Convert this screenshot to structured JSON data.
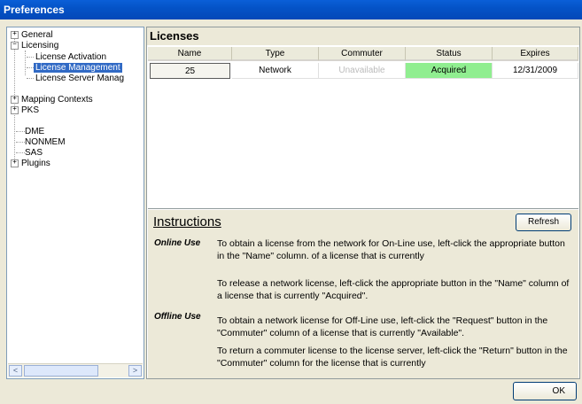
{
  "window": {
    "title": "Preferences"
  },
  "tree": {
    "items": [
      {
        "label": "General",
        "expander": "+"
      },
      {
        "label": "Licensing",
        "expander": "−"
      },
      {
        "label": "License Activation"
      },
      {
        "label": "License Management"
      },
      {
        "label": "License Server Manag"
      },
      {
        "label": "Mapping Contexts",
        "expander": "+"
      },
      {
        "label": "PKS",
        "expander": "+"
      },
      {
        "label": "DME"
      },
      {
        "label": "NONMEM"
      },
      {
        "label": "SAS"
      },
      {
        "label": "Plugins",
        "expander": "+"
      }
    ],
    "scroll_left": "<",
    "scroll_right": ">"
  },
  "licenses": {
    "title": "Licenses",
    "columns": [
      "Name",
      "Type",
      "Commuter",
      "Status",
      "Expires"
    ],
    "rows": [
      {
        "name": "25",
        "type": "Network",
        "commuter": "Unavailable",
        "status": "Acquired",
        "expires": "12/31/2009"
      }
    ]
  },
  "instructions": {
    "title": "Instructions",
    "refresh_label": "Refresh",
    "online_label": "Online Use",
    "online_text_1": "To obtain a license from the network for On-Line use, left-click the appropriate button in the \"Name\" column. of a license that is currently",
    "online_text_2": "To release a network license, left-click the appropriate button in the \"Name\" column of a license that is currently \"Acquired\".",
    "offline_label": "Offline Use",
    "offline_text_1": "To obtain a network license for Off-Line use, left-click the \"Request\" button in the \"Commuter\" column of a license that is currently \"Available\".",
    "offline_text_2": "To return a commuter license to the license server, left-click the \"Return\" button in the \"Commuter\" column for the license that is currently"
  },
  "footer": {
    "ok_label": "OK"
  },
  "colors": {
    "title_bar": "#0453c7",
    "selection": "#316ac5",
    "acquired_status": "#90ee90"
  }
}
